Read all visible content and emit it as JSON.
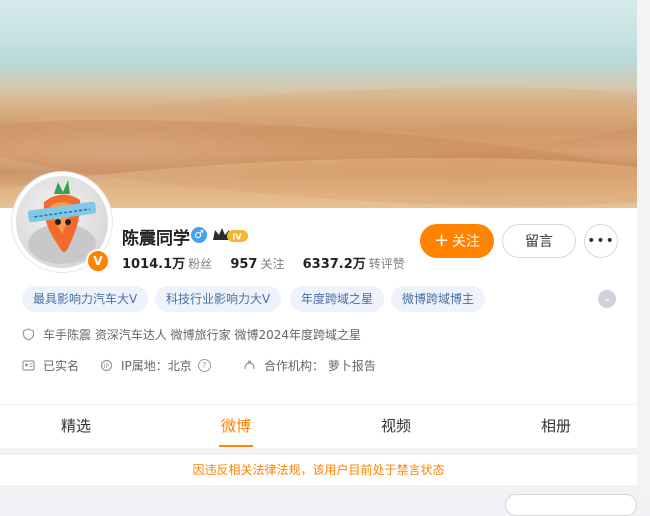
{
  "profile": {
    "name": "陈震同学",
    "gender_icon": "male-icon",
    "vip_badge": "IV",
    "avatar_badge": "V",
    "stats": [
      {
        "value": "1014.1万",
        "label": "粉丝"
      },
      {
        "value": "957",
        "label": "关注"
      },
      {
        "value": "6337.2万",
        "label": "转评赞"
      }
    ]
  },
  "actions": {
    "follow": "关注",
    "follow_plus": "+",
    "message": "留言",
    "more": "•••"
  },
  "tags": [
    "最具影响力汽车大V",
    "科技行业影响力大V",
    "年度跨域之星",
    "微博跨域博主"
  ],
  "info": {
    "bio": "车手陈震 资深汽车达人 微博旅行家 微博2024年度跨域之星",
    "realname": "已实名",
    "ip": "IP属地：北京",
    "agency": "合作机构：  萝卜报告"
  },
  "tabs": [
    "精选",
    "微博",
    "视频",
    "相册"
  ],
  "active_tab": "微博",
  "notice": "因违反相关法律法规，该用户目前处于禁言状态",
  "colors": {
    "accent": "#ff8200",
    "tag_bg": "#eef3fb",
    "tag_text": "#4a6fa5",
    "verify_blue": "#47a1f0"
  }
}
